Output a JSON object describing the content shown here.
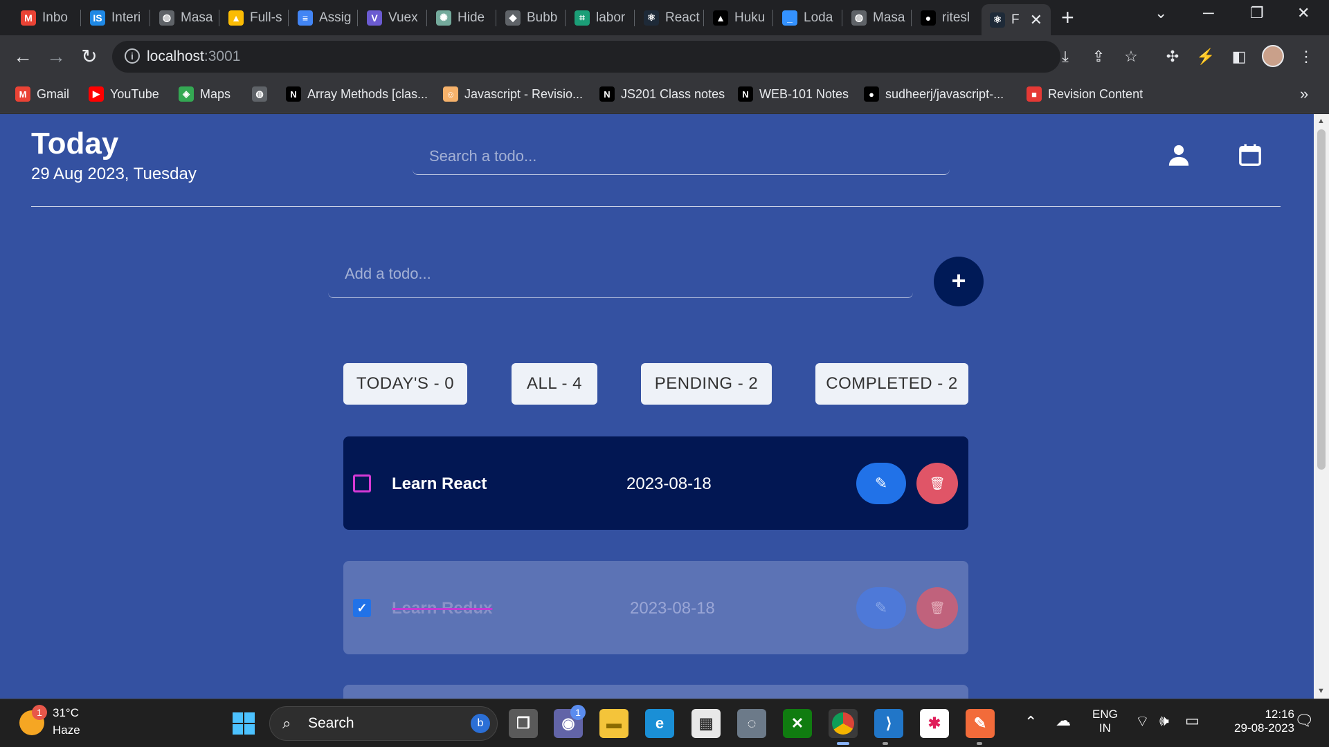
{
  "browser": {
    "tabs": [
      {
        "label": "Inbo",
        "icon": "gmail-icon",
        "color": "#ea4335",
        "glyph": "M"
      },
      {
        "label": "Interi",
        "icon": "is-icon",
        "color": "#1e88e5",
        "glyph": "IS"
      },
      {
        "label": "Masa",
        "icon": "globe-icon",
        "color": "#5f6368",
        "glyph": "◍"
      },
      {
        "label": "Full-s",
        "icon": "drive-icon",
        "color": "#fbbc04",
        "glyph": "▲"
      },
      {
        "label": "Assig",
        "icon": "docs-icon",
        "color": "#4285f4",
        "glyph": "≡"
      },
      {
        "label": "Vuex",
        "icon": "vuex-icon",
        "color": "#6b5bd1",
        "glyph": "V"
      },
      {
        "label": "Hide",
        "icon": "chatgpt-icon",
        "color": "#74aa9c",
        "glyph": "✺"
      },
      {
        "label": "Bubb",
        "icon": "bubble-icon",
        "color": "#5f6368",
        "glyph": "◆"
      },
      {
        "label": "labor",
        "icon": "replit-icon",
        "color": "#1b9e77",
        "glyph": "⌗"
      },
      {
        "label": "React",
        "icon": "react-icon",
        "color": "#1e2a38",
        "glyph": "⚛"
      },
      {
        "label": "Huku",
        "icon": "vercel-icon",
        "color": "#000000",
        "glyph": "▲"
      },
      {
        "label": "Loda",
        "icon": "lodash-icon",
        "color": "#3492ff",
        "glyph": "_"
      },
      {
        "label": "Masa",
        "icon": "globe-icon",
        "color": "#5f6368",
        "glyph": "◍"
      },
      {
        "label": "ritesl",
        "icon": "github-icon",
        "color": "#000000",
        "glyph": "●"
      },
      {
        "label": "F",
        "icon": "react-icon",
        "color": "#1e2a38",
        "glyph": "⚛",
        "active": true
      }
    ],
    "url_host": "localhost",
    "url_port": ":3001",
    "bookmarks": [
      {
        "label": "Gmail",
        "icon": "gmail-icon",
        "color": "#ea4335",
        "glyph": "M"
      },
      {
        "label": "YouTube",
        "icon": "youtube-icon",
        "color": "#ff0000",
        "glyph": "▶"
      },
      {
        "label": "Maps",
        "icon": "maps-icon",
        "color": "#34a853",
        "glyph": "◈"
      },
      {
        "label": "",
        "icon": "globe-icon",
        "color": "#5f6368",
        "glyph": "◍"
      },
      {
        "label": "Array Methods [clas...",
        "icon": "notion-icon",
        "color": "#000000",
        "glyph": "N"
      },
      {
        "label": "Javascript - Revisio...",
        "icon": "avatar-icon",
        "color": "#f6b26b",
        "glyph": "☺"
      },
      {
        "label": "JS201 Class notes",
        "icon": "notion-icon",
        "color": "#000000",
        "glyph": "N"
      },
      {
        "label": "WEB-101 Notes",
        "icon": "notion-icon",
        "color": "#000000",
        "glyph": "N"
      },
      {
        "label": "sudheerj/javascript-...",
        "icon": "github-icon",
        "color": "#000000",
        "glyph": "●"
      },
      {
        "label": "Revision Content",
        "icon": "bookmark-red-icon",
        "color": "#e53935",
        "glyph": "■"
      }
    ]
  },
  "app": {
    "title": "Today",
    "date": "29 Aug 2023, Tuesday",
    "search_placeholder": "Search a todo...",
    "add_placeholder": "Add a todo...",
    "add_button": "+",
    "filters": [
      {
        "label": "TODAY'S - 0"
      },
      {
        "label": "ALL - 4"
      },
      {
        "label": "PENDING - 2"
      },
      {
        "label": "COMPLETED - 2"
      }
    ],
    "todos": [
      {
        "text": "Learn React",
        "date": "2023-08-18",
        "completed": false
      },
      {
        "text": "Learn Redux",
        "date": "2023-08-18",
        "completed": true
      }
    ]
  },
  "taskbar": {
    "temperature": "31°C",
    "condition": "Haze",
    "weather_badge": "1",
    "search_label": "Search",
    "teams_badge": "1",
    "language": "ENG",
    "region": "IN",
    "time": "12:16",
    "date": "29-08-2023"
  }
}
